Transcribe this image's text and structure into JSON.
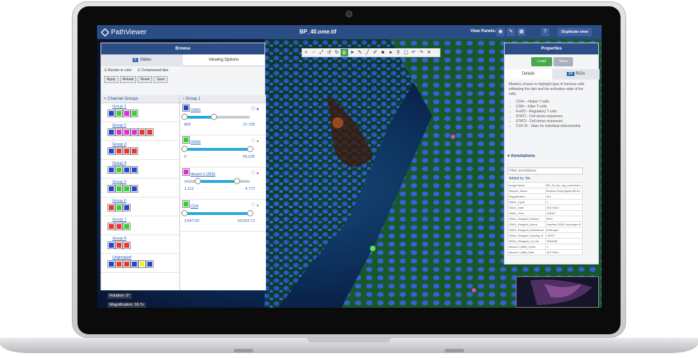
{
  "app": {
    "brand": "PathViewer",
    "file_name": "BP_40.ome.tif",
    "view_panels_label": "View Panels:",
    "duplicate_view": "Duplicate view"
  },
  "left_panel": {
    "title": "Browse",
    "slides_tab": "Slides",
    "slides_count": "5",
    "viewing_tab": "Viewing Options",
    "render_color": "Render in color",
    "compressed": "Compressed tiles",
    "buttons": {
      "apply": "Apply",
      "reload": "Reload",
      "reset": "Reset",
      "save": "Save"
    },
    "channel_groups_title": "Channel Groups",
    "current_group": "Group 1",
    "groups": [
      "Group 1",
      "Group 2",
      "Group 3",
      "Group 4",
      "Group 5",
      "Group 6",
      "Group 7",
      "Group 8",
      "Ungrouped"
    ]
  },
  "channels": [
    {
      "name": "DNA1",
      "min": "809",
      "max": "27,733",
      "color": "#1f47d6"
    },
    {
      "name": "DNA2",
      "min": "0",
      "max": "65,535",
      "color": "#2fd12f"
    },
    {
      "name": "bleach-1 (555)",
      "min": "1,113",
      "max": "4,773",
      "color": "#e42ad8"
    },
    {
      "name": "CD4",
      "min": "3,647.00",
      "max": "50,023.72",
      "color": "#2fd12f"
    }
  ],
  "right_panel": {
    "title": "Properties",
    "load": "Load",
    "save": "Save",
    "details_tab": "Details",
    "rois_tab": "ROIs",
    "rois_count": "34",
    "description": "Markers chosen to highlight type of immune cells infiltrating the skin and the activation state of the cells.",
    "bullets": [
      "CD4+ - Helper T-cells",
      "CD8+ - Killer T-cells",
      "FoxP3 - Regulatory T-cells",
      "STAT1 - Cell stress responses",
      "STAT3 - Cell stress responses",
      "COX-IV - Stain for individual mitochondria"
    ],
    "annotations_title": "Annotations",
    "filter_placeholder": "Filter annotations",
    "added_by": "Added by: Me",
    "meta": [
      [
        "Image Name",
        "BP_40_tile_reg_corrected.o"
      ],
      [
        "Sample_Name",
        "Bullous Pemphigoid (BD19-"
      ],
      [
        "Magnification",
        "40x"
      ],
      [
        "DNA1_Cycle",
        "1"
      ],
      [
        "DNA1_Date",
        "20170324"
      ],
      [
        "DNA1_Time",
        "144607"
      ],
      [
        "DNA1_Reagent_Dilution",
        "5000"
      ],
      [
        "DNA1_Reagent_Name",
        "Hoechst 33342 Invitrogen H"
      ],
      [
        "DNA1_Reagent_Manufactur",
        "Invitrogen"
      ],
      [
        "DNA1_Reagent_Catalog_N",
        "H3570"
      ],
      [
        "DNA1_Reagent_Lot_No",
        "1940436"
      ],
      [
        "bleach-1 (488)_Cycle",
        "1"
      ],
      [
        "bleach-1 (488)_Date",
        "20170324"
      ]
    ]
  },
  "status": {
    "rotation": "Rotation: 0°",
    "magnification": "Magnification: 16.7x"
  }
}
